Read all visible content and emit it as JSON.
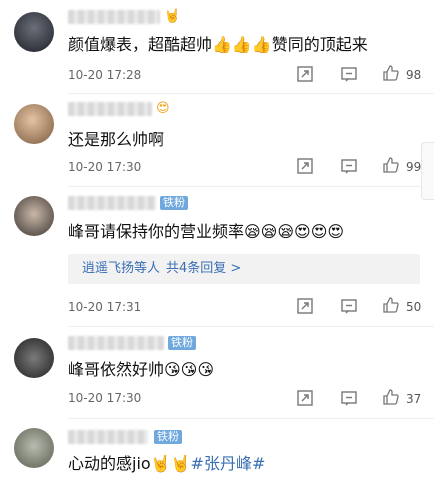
{
  "comments": [
    {
      "text": "颜值爆表，超酷超帅👍👍👍赞同的顶起来",
      "time": "10-20 17:28",
      "likes": "98",
      "badge": "🤘"
    },
    {
      "text": "还是那么帅啊",
      "time": "10-20 17:30",
      "likes": "99",
      "badge": "😍"
    },
    {
      "text": "峰哥请保持你的营业频率😪😪😪😍😍😍",
      "time": "10-20 17:31",
      "likes": "50",
      "badge": "铁粉",
      "reply_text": "逍遥飞扬等人",
      "reply_link": "共4条回复 >"
    },
    {
      "text": "峰哥依然好帅😘😘😘",
      "time": "10-20 17:30",
      "likes": "37",
      "badge": "铁粉"
    },
    {
      "text_main": "心动的感jio🤘🤘",
      "hashtag": "#张丹峰#",
      "badge": "铁粉"
    }
  ],
  "icons": [
    "share-icon",
    "comment-icon",
    "like-icon"
  ],
  "colors": {
    "link": "#3a6fb5",
    "badge": "#6fa8dc"
  }
}
